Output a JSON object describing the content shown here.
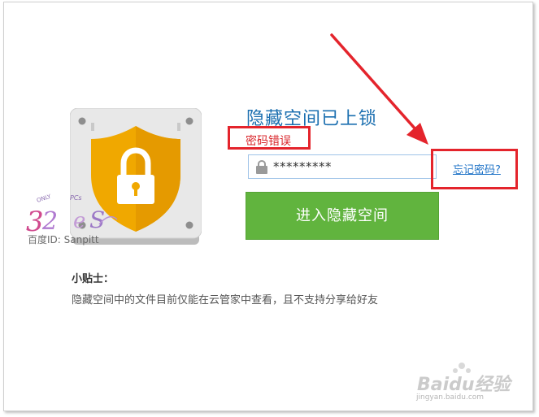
{
  "header": {
    "title": "隐藏空间已上锁"
  },
  "error": {
    "message": "密码错误"
  },
  "password": {
    "value": "*********"
  },
  "forgot": {
    "label": "忘记密码?"
  },
  "enter_button": {
    "label": "进入隐藏空间"
  },
  "tips": {
    "title": "小贴士：",
    "text": "隐藏空间中的文件目前仅能在云管家中查看，且不支持分享给好友"
  },
  "watermark": {
    "id_text": "百度ID: Sanpitt",
    "logo_text": "ONLY PCs 32"
  },
  "baidu_watermark": {
    "brand": "Baidu经验",
    "url": "jingyan.baidu.com"
  },
  "colors": {
    "accent_blue": "#1b6fb0",
    "error_red": "#d9262b",
    "annotation_red": "#e4242c",
    "button_green": "#61b43e",
    "shield_orange": "#f0a800"
  },
  "icons": {
    "safe": "locked-safe-icon",
    "field_lock": "lock-icon",
    "arrow": "red-arrow-icon"
  }
}
